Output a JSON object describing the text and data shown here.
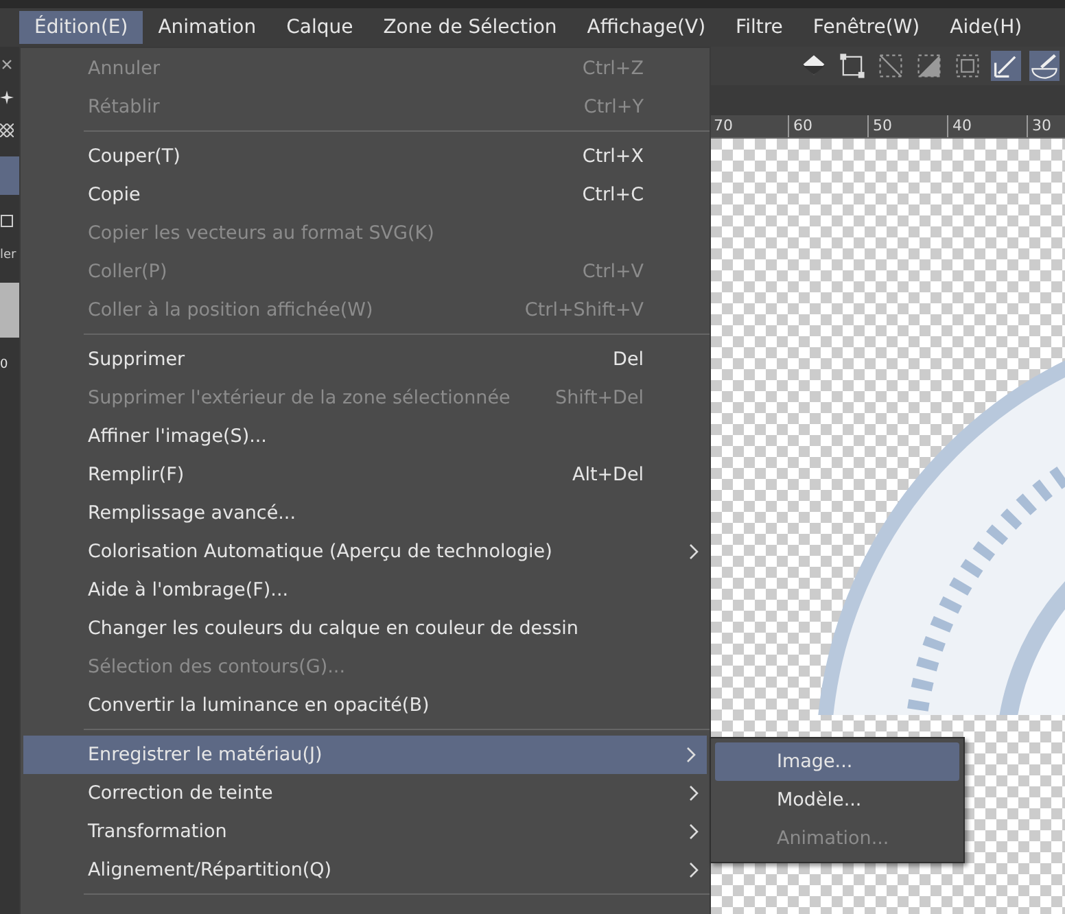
{
  "menu_bar": [
    {
      "label": "Édition(E)",
      "selected": true
    },
    {
      "label": "Animation",
      "selected": false
    },
    {
      "label": "Calque",
      "selected": false
    },
    {
      "label": "Zone de Sélection",
      "selected": false
    },
    {
      "label": "Affichage(V)",
      "selected": false
    },
    {
      "label": "Filtre",
      "selected": false
    },
    {
      "label": "Fenêtre(W)",
      "selected": false
    },
    {
      "label": "Aide(H)",
      "selected": false
    }
  ],
  "side_panel": {
    "labels": [
      "ler",
      "0"
    ]
  },
  "ruler": {
    "labels": [
      "70",
      "60",
      "50",
      "40",
      "30"
    ]
  },
  "edit_menu": [
    {
      "kind": "item",
      "label": "Annuler",
      "shortcut": "Ctrl+Z",
      "disabled": true,
      "selected": false,
      "submenu": false
    },
    {
      "kind": "item",
      "label": "Rétablir",
      "shortcut": "Ctrl+Y",
      "disabled": true,
      "selected": false,
      "submenu": false
    },
    {
      "kind": "separator"
    },
    {
      "kind": "item",
      "label": "Couper(T)",
      "shortcut": "Ctrl+X",
      "disabled": false,
      "selected": false,
      "submenu": false
    },
    {
      "kind": "item",
      "label": "Copie",
      "shortcut": "Ctrl+C",
      "disabled": false,
      "selected": false,
      "submenu": false
    },
    {
      "kind": "item",
      "label": "Copier les vecteurs au format SVG(K)",
      "disabled": true,
      "selected": false,
      "submenu": false
    },
    {
      "kind": "item",
      "label": "Coller(P)",
      "shortcut": "Ctrl+V",
      "disabled": true,
      "selected": false,
      "submenu": false
    },
    {
      "kind": "item",
      "label": "Coller à la position affichée(W)",
      "shortcut": "Ctrl+Shift+V",
      "disabled": true,
      "selected": false,
      "submenu": false
    },
    {
      "kind": "separator"
    },
    {
      "kind": "item",
      "label": "Supprimer",
      "shortcut": "Del",
      "disabled": false,
      "selected": false,
      "submenu": false
    },
    {
      "kind": "item",
      "label": "Supprimer l'extérieur de la zone sélectionnée",
      "shortcut": "Shift+Del",
      "disabled": true,
      "selected": false,
      "submenu": false
    },
    {
      "kind": "item",
      "label": "Affiner l'image(S)...",
      "disabled": false,
      "selected": false,
      "submenu": false
    },
    {
      "kind": "item",
      "label": "Remplir(F)",
      "shortcut": "Alt+Del",
      "disabled": false,
      "selected": false,
      "submenu": false
    },
    {
      "kind": "item",
      "label": "Remplissage avancé...",
      "disabled": false,
      "selected": false,
      "submenu": false
    },
    {
      "kind": "item",
      "label": "Colorisation Automatique (Aperçu de technologie)",
      "disabled": false,
      "selected": false,
      "submenu": true
    },
    {
      "kind": "item",
      "label": "Aide à l'ombrage(F)...",
      "disabled": false,
      "selected": false,
      "submenu": false
    },
    {
      "kind": "item",
      "label": "Changer les couleurs du calque en couleur de dessin",
      "disabled": false,
      "selected": false,
      "submenu": false
    },
    {
      "kind": "item",
      "label": "Sélection des contours(G)...",
      "disabled": true,
      "selected": false,
      "submenu": false
    },
    {
      "kind": "item",
      "label": "Convertir la luminance en opacité(B)",
      "disabled": false,
      "selected": false,
      "submenu": false
    },
    {
      "kind": "separator"
    },
    {
      "kind": "item",
      "label": "Enregistrer le matériau(J)",
      "disabled": false,
      "selected": true,
      "submenu": true
    },
    {
      "kind": "item",
      "label": "Correction de teinte",
      "disabled": false,
      "selected": false,
      "submenu": true
    },
    {
      "kind": "item",
      "label": "Transformation",
      "disabled": false,
      "selected": false,
      "submenu": true
    },
    {
      "kind": "item",
      "label": "Alignement/Répartition(Q)",
      "disabled": false,
      "selected": false,
      "submenu": true
    },
    {
      "kind": "separator"
    }
  ],
  "submenu": [
    {
      "label": "Image...",
      "selected": true,
      "disabled": false
    },
    {
      "label": "Modèle...",
      "selected": false,
      "disabled": false
    },
    {
      "label": "Animation...",
      "selected": false,
      "disabled": true
    }
  ]
}
